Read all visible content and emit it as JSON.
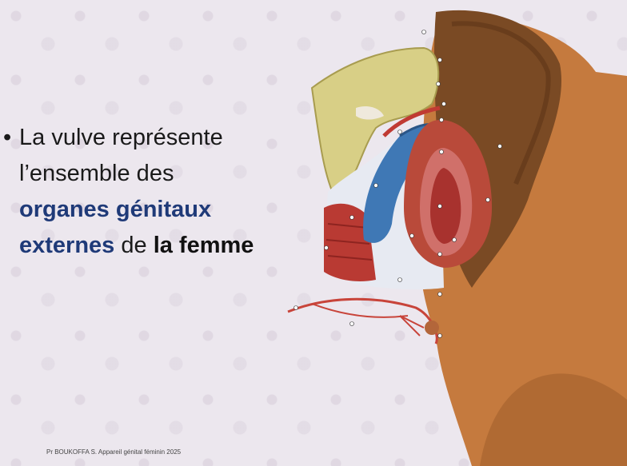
{
  "slide": {
    "bullet": "•",
    "line1": "La vulve représente",
    "line2": "l’ensemble des",
    "emph1": "organes génitaux",
    "emph2": "externes",
    "mid": " de ",
    "emph3": "la femme"
  },
  "footer": "Pr BOUKOFFA S. Appareil génital féminin 2025",
  "illustration": {
    "name": "anatomical-illustration-vulva"
  }
}
